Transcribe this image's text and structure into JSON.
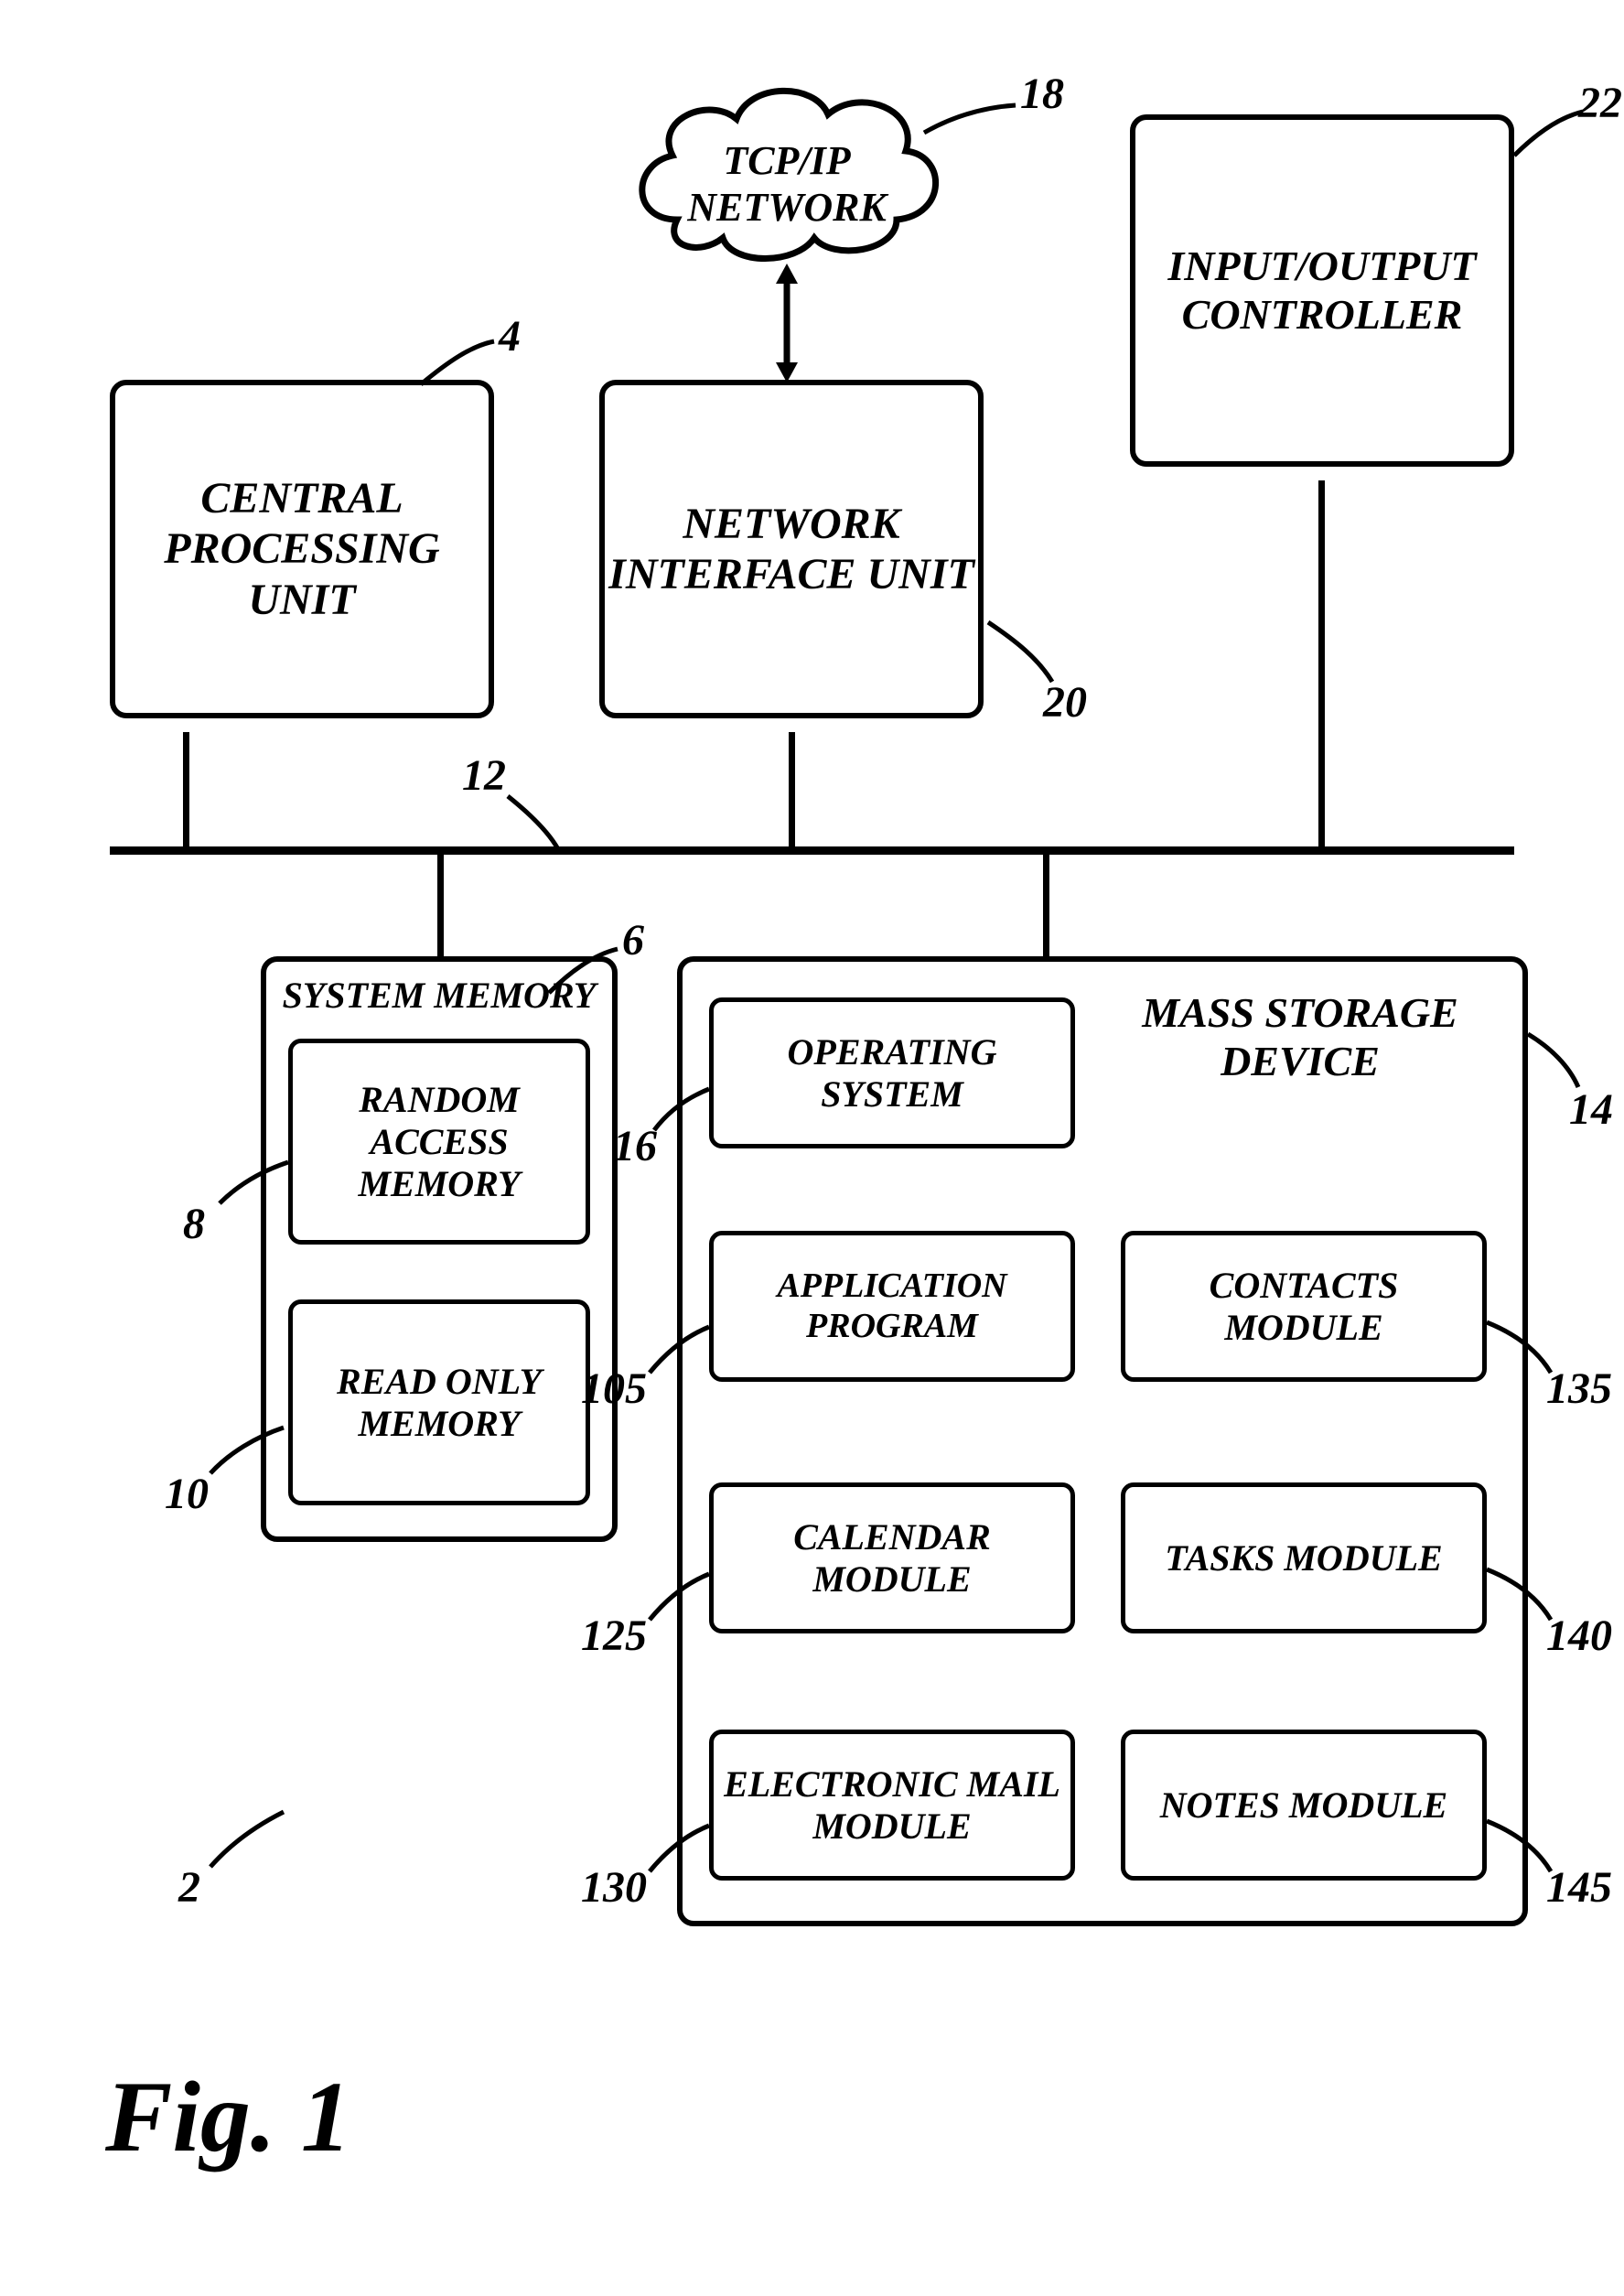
{
  "figure_label": "Fig. 1",
  "network": {
    "cloud_label": "TCP/IP NETWORK"
  },
  "top_row": {
    "cpu": "CENTRAL PROCESSING UNIT",
    "niu": "NETWORK INTERFACE UNIT",
    "io": "INPUT/OUTPUT CONTROLLER"
  },
  "system_memory": {
    "title": "SYSTEM MEMORY",
    "ram": "RANDOM ACCESS MEMORY",
    "rom": "READ ONLY MEMORY"
  },
  "mass_storage": {
    "title": "MASS STORAGE DEVICE",
    "os": "OPERATING SYSTEM",
    "contacts": "CONTACTS MODULE",
    "app": "APPLICATION PROGRAM",
    "tasks": "TASKS MODULE",
    "calendar": "CALENDAR MODULE",
    "notes": "NOTES MODULE",
    "email": "ELECTRONIC MAIL MODULE"
  },
  "refs": {
    "system": "2",
    "cpu": "4",
    "sm": "6",
    "ram": "8",
    "rom": "10",
    "bus": "12",
    "msd": "14",
    "os": "16",
    "cloud": "18",
    "niu": "20",
    "io": "22",
    "app": "105",
    "cal": "125",
    "email": "130",
    "contacts": "135",
    "tasks": "140",
    "notes": "145"
  }
}
